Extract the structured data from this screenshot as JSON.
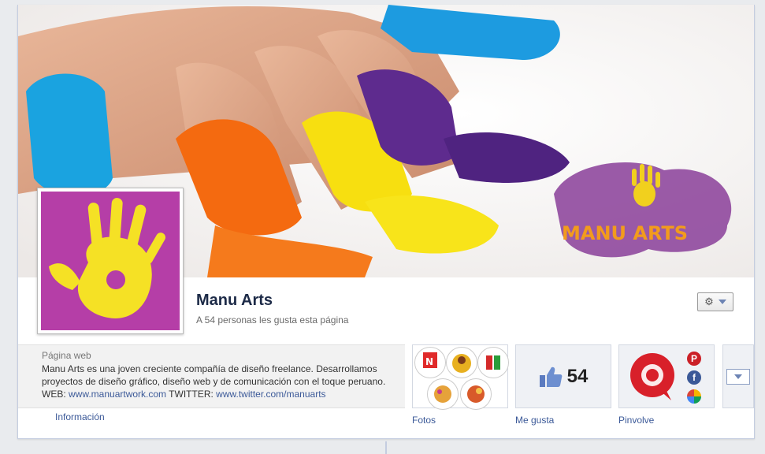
{
  "page": {
    "name": "Manu Arts",
    "likes_line": "A 54 personas les gusta esta página",
    "category": "Página web",
    "description_text": "Manu Arts es una joven creciente compañía de diseño freelance. Desarrollamos proyectos de diseño gráfico, diseño web y de comunicación con el toque peruano. WEB: ",
    "web_link": "www.manuartwork.com",
    "twitter_prefix": " TWITTER: ",
    "twitter_link": "www.twitter.com/manuarts",
    "cover_logo_text": "MANU ARTS"
  },
  "tabs": {
    "info": "Información",
    "photos": "Fotos",
    "likes": "Me gusta",
    "likes_count": "54",
    "pinvolve": "Pinvolve"
  },
  "icons": {
    "gear": "gear-icon",
    "thumbs_up": "thumbs-up-icon",
    "pinterest": "pinterest-icon",
    "facebook": "facebook-icon",
    "instagram": "instagram-icon"
  },
  "colors": {
    "brand_purple": "#b53ea7",
    "brand_yellow": "#f5e125",
    "link_blue": "#3b5998"
  }
}
